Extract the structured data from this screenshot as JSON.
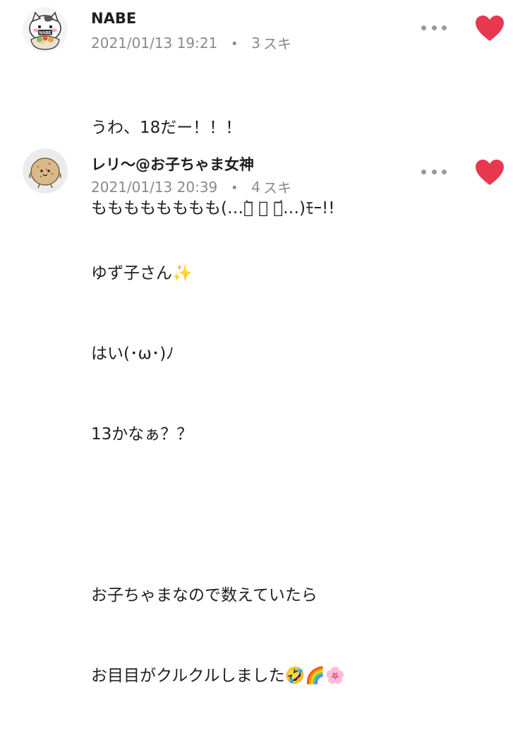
{
  "colors": {
    "text": "#1f1f1f",
    "meta": "#8a8a8a",
    "heart": "#e8384f",
    "dots": "#9a9a9a"
  },
  "comments": [
    {
      "author": "NABE",
      "timestamp": "2021/01/13 19:21",
      "separator": "・",
      "like_count": "3",
      "like_label": "スキ",
      "avatar_icon": "cat-avatar-icon",
      "lines": [
        "うわ、18だー！！！",
        "もももももももも(…ꐦ᷅ ⌓︎ ꐦ᷄…)ﾓｰ!!"
      ]
    },
    {
      "author": "レリ〜@お子ちゃま女神",
      "timestamp": "2021/01/13 20:39",
      "separator": "・",
      "like_count": "4",
      "like_label": "スキ",
      "avatar_icon": "potato-avatar-icon",
      "lines": [
        "ゆず子さん✨",
        "はい(･ω･)ﾉ",
        "13かなぁ？？",
        "",
        "お子ちゃまなので数えていたら",
        "お目目がクルクルしました🤣🌈🌸"
      ]
    }
  ]
}
